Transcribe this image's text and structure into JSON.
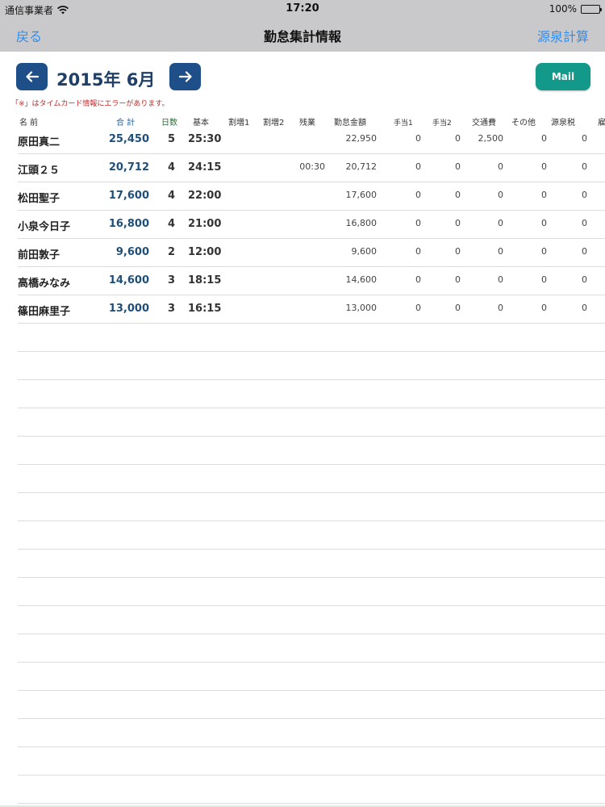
{
  "status_bar": {
    "carrier": "通信事業者",
    "time": "17:20",
    "battery": "100%"
  },
  "nav": {
    "back_label": "戻る",
    "title": "勤怠集計情報",
    "right_label": "源泉計算"
  },
  "month_selector": {
    "month": "2015年 6月",
    "mail_label": "Mail"
  },
  "error_note": "「※」はタイムカード情報にエラーがあります。",
  "columns": {
    "name": "名 前",
    "total": "合 計",
    "days": "日数",
    "basic": "基本",
    "extra1": "割増1",
    "extra2": "割増2",
    "overtime": "残業",
    "amount": "勤怠金額",
    "allow1": "手当1",
    "allow2": "手当2",
    "transport": "交通費",
    "other": "その他",
    "tax": "源泉税",
    "cut": "雇"
  },
  "rows": [
    {
      "name": "原田真二",
      "total": "25,450",
      "days": "5",
      "basic": "25:30",
      "extra1": "",
      "extra2": "",
      "overtime": "",
      "amount": "22,950",
      "allow1": "0",
      "allow2": "0",
      "transport": "2,500",
      "other": "0",
      "tax": "0"
    },
    {
      "name": "江頭２５",
      "total": "20,712",
      "days": "4",
      "basic": "24:15",
      "extra1": "",
      "extra2": "",
      "overtime": "00:30",
      "amount": "20,712",
      "allow1": "0",
      "allow2": "0",
      "transport": "0",
      "other": "0",
      "tax": "0"
    },
    {
      "name": "松田聖子",
      "total": "17,600",
      "days": "4",
      "basic": "22:00",
      "extra1": "",
      "extra2": "",
      "overtime": "",
      "amount": "17,600",
      "allow1": "0",
      "allow2": "0",
      "transport": "0",
      "other": "0",
      "tax": "0"
    },
    {
      "name": "小泉今日子",
      "total": "16,800",
      "days": "4",
      "basic": "21:00",
      "extra1": "",
      "extra2": "",
      "overtime": "",
      "amount": "16,800",
      "allow1": "0",
      "allow2": "0",
      "transport": "0",
      "other": "0",
      "tax": "0"
    },
    {
      "name": "前田敦子",
      "total": "9,600",
      "days": "2",
      "basic": "12:00",
      "extra1": "",
      "extra2": "",
      "overtime": "",
      "amount": "9,600",
      "allow1": "0",
      "allow2": "0",
      "transport": "0",
      "other": "0",
      "tax": "0"
    },
    {
      "name": "高橋みなみ",
      "total": "14,600",
      "days": "3",
      "basic": "18:15",
      "extra1": "",
      "extra2": "",
      "overtime": "",
      "amount": "14,600",
      "allow1": "0",
      "allow2": "0",
      "transport": "0",
      "other": "0",
      "tax": "0"
    },
    {
      "name": "篠田麻里子",
      "total": "13,000",
      "days": "3",
      "basic": "16:15",
      "extra1": "",
      "extra2": "",
      "overtime": "",
      "amount": "13,000",
      "allow1": "0",
      "allow2": "0",
      "transport": "0",
      "other": "0",
      "tax": "0"
    }
  ],
  "icons": {
    "wifi": "wifi-icon",
    "battery": "battery-icon",
    "prev": "arrow-left-icon",
    "next": "arrow-right-icon"
  },
  "colors": {
    "nav_bg": "#c9c9cc",
    "link": "#2e8ef0",
    "arrow_button": "#1f4f88",
    "mail_button": "#12998a",
    "error_text": "#c02a2a"
  }
}
